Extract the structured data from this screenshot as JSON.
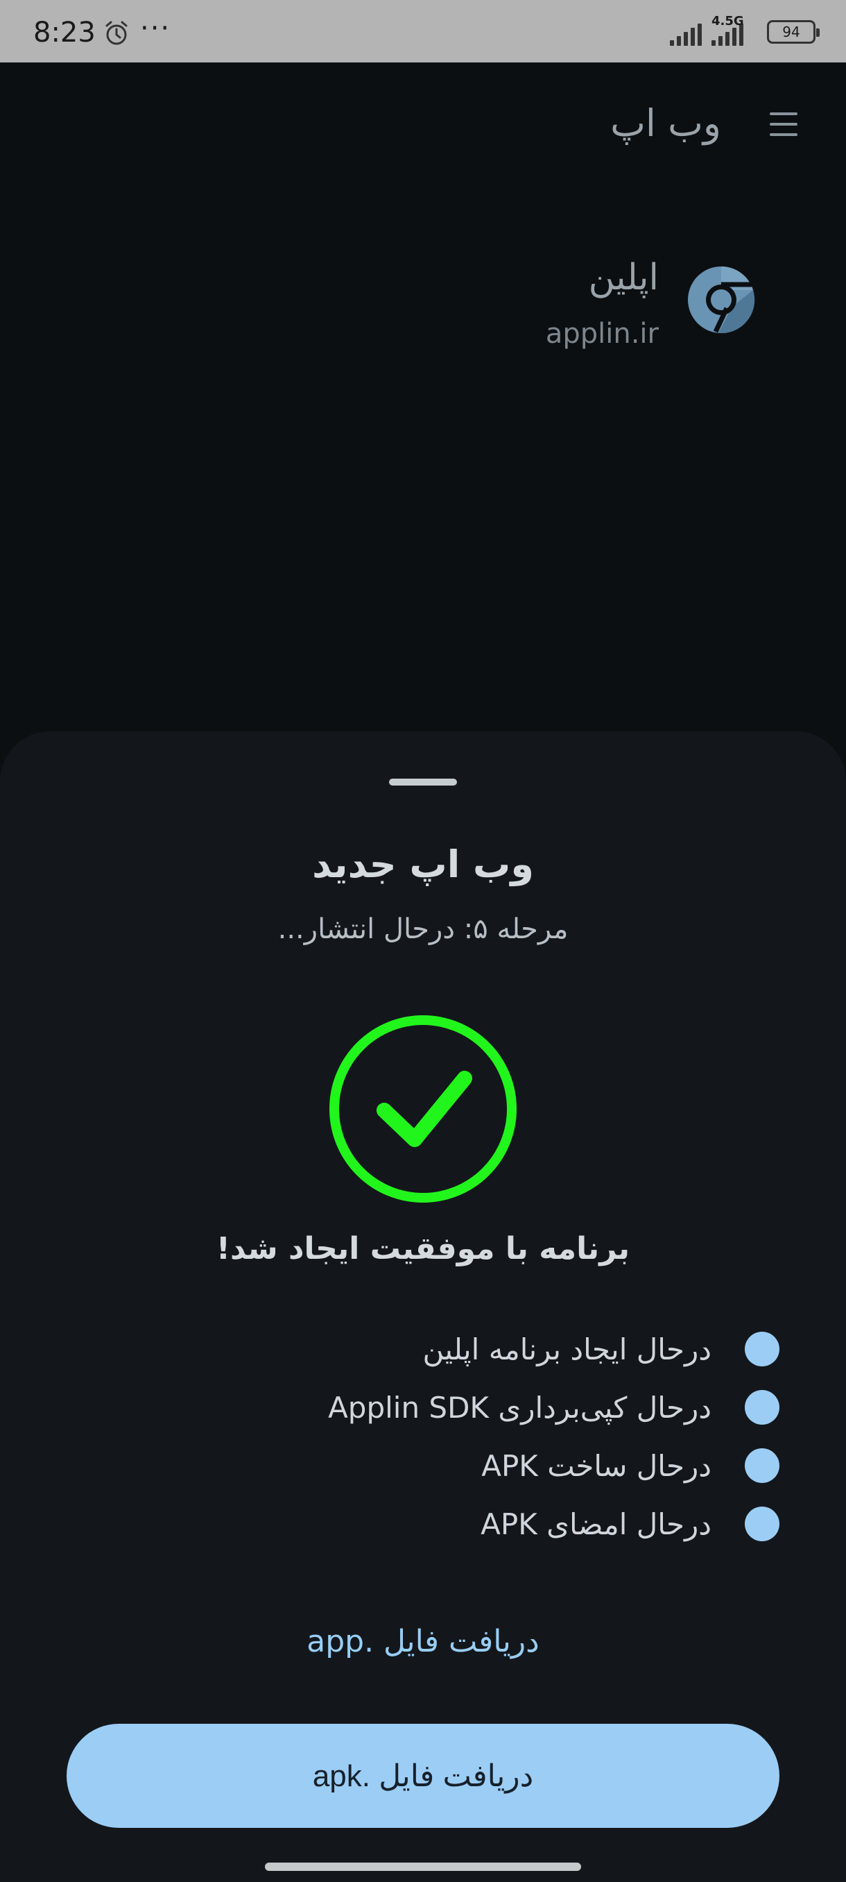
{
  "status_bar": {
    "time": "8:23",
    "more": "···",
    "network": "4.5G",
    "battery": "94",
    "icons": [
      "alarm-icon",
      "signal-icon",
      "battery-icon"
    ]
  },
  "app_bar": {
    "title": "وب اپ",
    "menu_icon": "hamburger-menu-icon"
  },
  "app_info": {
    "name": "اپلین",
    "domain": "applin.ir",
    "icon": "chrome-icon"
  },
  "sheet": {
    "title": "وب اپ جدید",
    "subtitle": "مرحله ۵: درحال انتشار...",
    "success_icon": "check-circle-icon",
    "success_text": "برنامه با موفقیت ایجاد شد!",
    "steps": [
      {
        "label": "درحال ایجاد برنامه اپلین"
      },
      {
        "label": "درحال کپی‌برداری Applin SDK"
      },
      {
        "label": "درحال ساخت APK"
      },
      {
        "label": "درحال امضای APK"
      }
    ],
    "app_file_link": "دریافت فایل .app",
    "apk_button": "دریافت فایل .apk"
  },
  "colors": {
    "background": "#0c0f12",
    "sheet": "#13171b",
    "accent": "#9ccdf5",
    "success": "#22f51c"
  }
}
